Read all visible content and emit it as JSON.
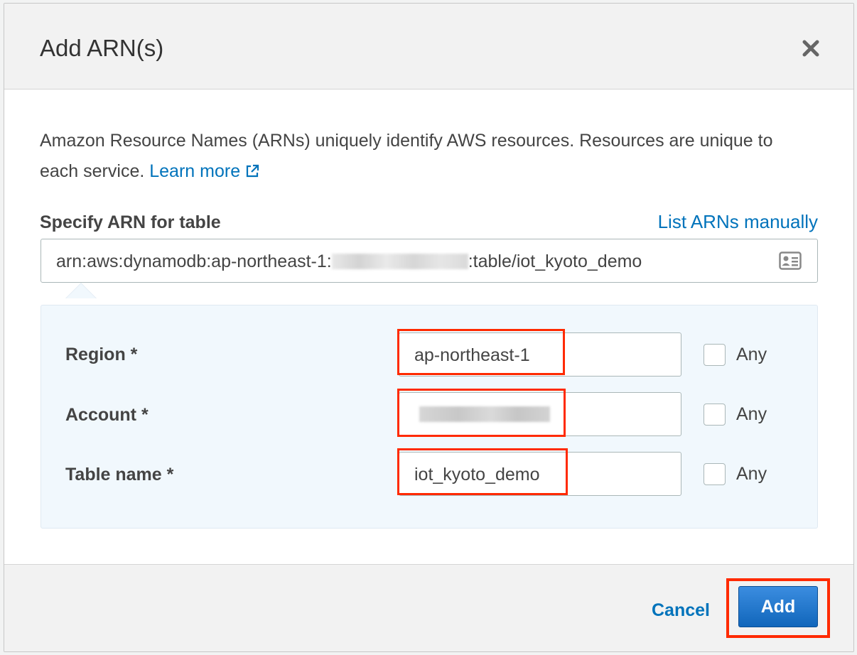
{
  "dialog": {
    "title": "Add ARN(s)",
    "description": "Amazon Resource Names (ARNs) uniquely identify AWS resources. Resources are unique to each service.",
    "learn_more": "Learn more"
  },
  "arn": {
    "label": "Specify ARN for table",
    "list_manually": "List ARNs manually",
    "prefix": "arn:aws:dynamodb:ap-northeast-1:",
    "suffix": ":table/iot_kyoto_demo"
  },
  "fields": {
    "region": {
      "label": "Region *",
      "value": "ap-northeast-1"
    },
    "account": {
      "label": "Account *",
      "value": ""
    },
    "table_name": {
      "label": "Table name *",
      "value": "iot_kyoto_demo"
    },
    "any_label": "Any"
  },
  "footer": {
    "cancel": "Cancel",
    "add": "Add"
  },
  "colors": {
    "link": "#0073bb",
    "primary": "#1166bb",
    "highlight": "#ff2a00",
    "panel_bg": "#f1f8fd"
  }
}
